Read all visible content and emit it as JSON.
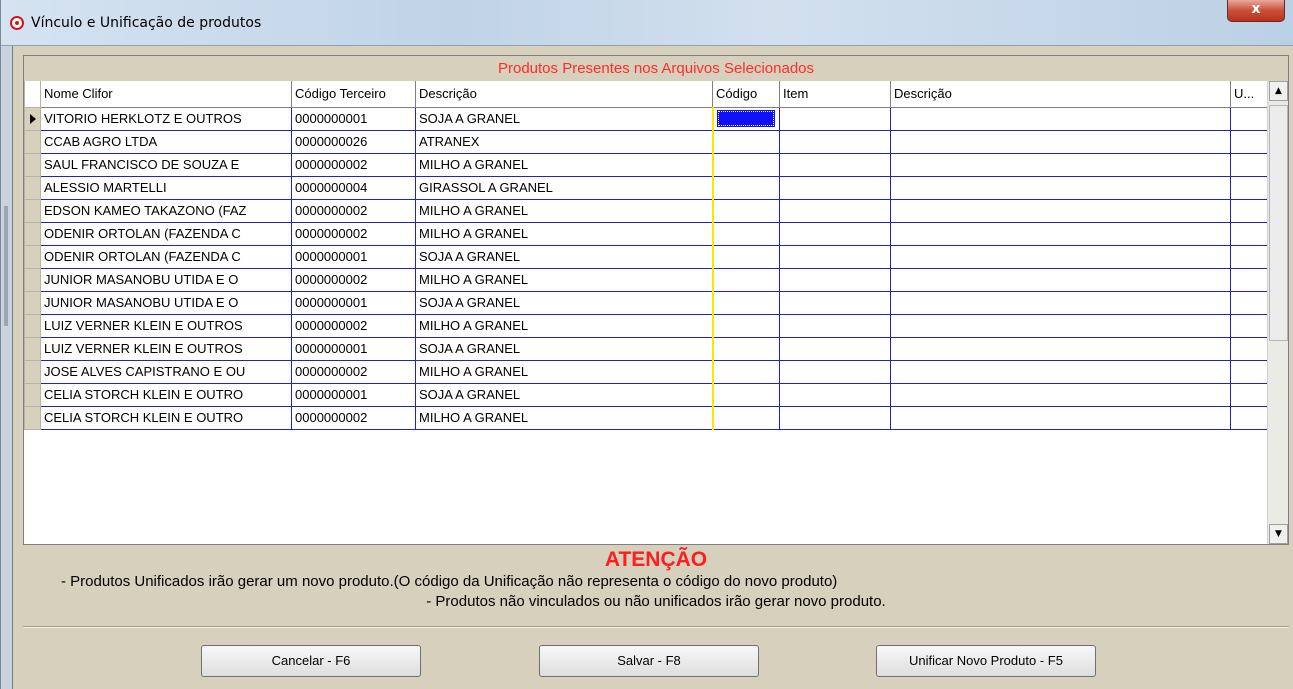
{
  "window": {
    "title": "Vínculo e Unificação de produtos",
    "close_label": "x"
  },
  "grid": {
    "caption": "Produtos Presentes nos Arquivos Selecionados",
    "headers": [
      "Nome Clifor",
      "Código Terceiro",
      "Descrição",
      "Código",
      "Item",
      "Descrição",
      "U..."
    ],
    "rows": [
      [
        "VITORIO HERKLOTZ E OUTROS",
        "0000000001",
        "SOJA A GRANEL",
        "",
        "",
        "",
        ""
      ],
      [
        "CCAB AGRO LTDA",
        "0000000026",
        "ATRANEX",
        "",
        "",
        "",
        ""
      ],
      [
        "SAUL FRANCISCO DE SOUZA E",
        "0000000002",
        "MILHO A GRANEL",
        "",
        "",
        "",
        ""
      ],
      [
        "ALESSIO MARTELLI",
        "0000000004",
        "GIRASSOL A GRANEL",
        "",
        "",
        "",
        ""
      ],
      [
        "EDSON KAMEO TAKAZONO (FAZ",
        "0000000002",
        "MILHO A GRANEL",
        "",
        "",
        "",
        ""
      ],
      [
        "ODENIR ORTOLAN (FAZENDA C",
        "0000000002",
        "MILHO A GRANEL",
        "",
        "",
        "",
        ""
      ],
      [
        "ODENIR ORTOLAN (FAZENDA C",
        "0000000001",
        "SOJA A GRANEL",
        "",
        "",
        "",
        ""
      ],
      [
        "JUNIOR MASANOBU UTIDA E O",
        "0000000002",
        "MILHO A GRANEL",
        "",
        "",
        "",
        ""
      ],
      [
        "JUNIOR MASANOBU UTIDA E O",
        "0000000001",
        "SOJA A GRANEL",
        "",
        "",
        "",
        ""
      ],
      [
        "LUIZ VERNER KLEIN E OUTROS",
        "0000000002",
        "MILHO A GRANEL",
        "",
        "",
        "",
        ""
      ],
      [
        "LUIZ VERNER KLEIN E OUTROS",
        "0000000001",
        "SOJA A GRANEL",
        "",
        "",
        "",
        ""
      ],
      [
        "JOSE ALVES CAPISTRANO E OU",
        "0000000002",
        "MILHO A GRANEL",
        "",
        "",
        "",
        ""
      ],
      [
        "CELIA STORCH KLEIN E OUTRO",
        "0000000001",
        "SOJA A GRANEL",
        "",
        "",
        "",
        ""
      ],
      [
        "CELIA STORCH KLEIN E OUTRO",
        "0000000002",
        "MILHO A GRANEL",
        "",
        "",
        "",
        ""
      ]
    ],
    "selected_row": 0,
    "selected_col": 3
  },
  "attention": {
    "title": "ATENÇÃO",
    "line1": "- Produtos Unificados irão gerar um novo produto.(O código da Unificação não representa o código do novo produto)",
    "line2": "- Produtos não vinculados ou não unificados irão gerar novo produto."
  },
  "buttons": {
    "cancel": "Cancelar - F6",
    "save": "Salvar - F8",
    "unify": "Unificar Novo Produto - F5"
  },
  "colors": {
    "caption_text": "#ff2d2d",
    "grid_lines": "#2222cc",
    "selection": "#1010f8",
    "divider": "#ffe600",
    "attention": "#ff1e1e"
  }
}
